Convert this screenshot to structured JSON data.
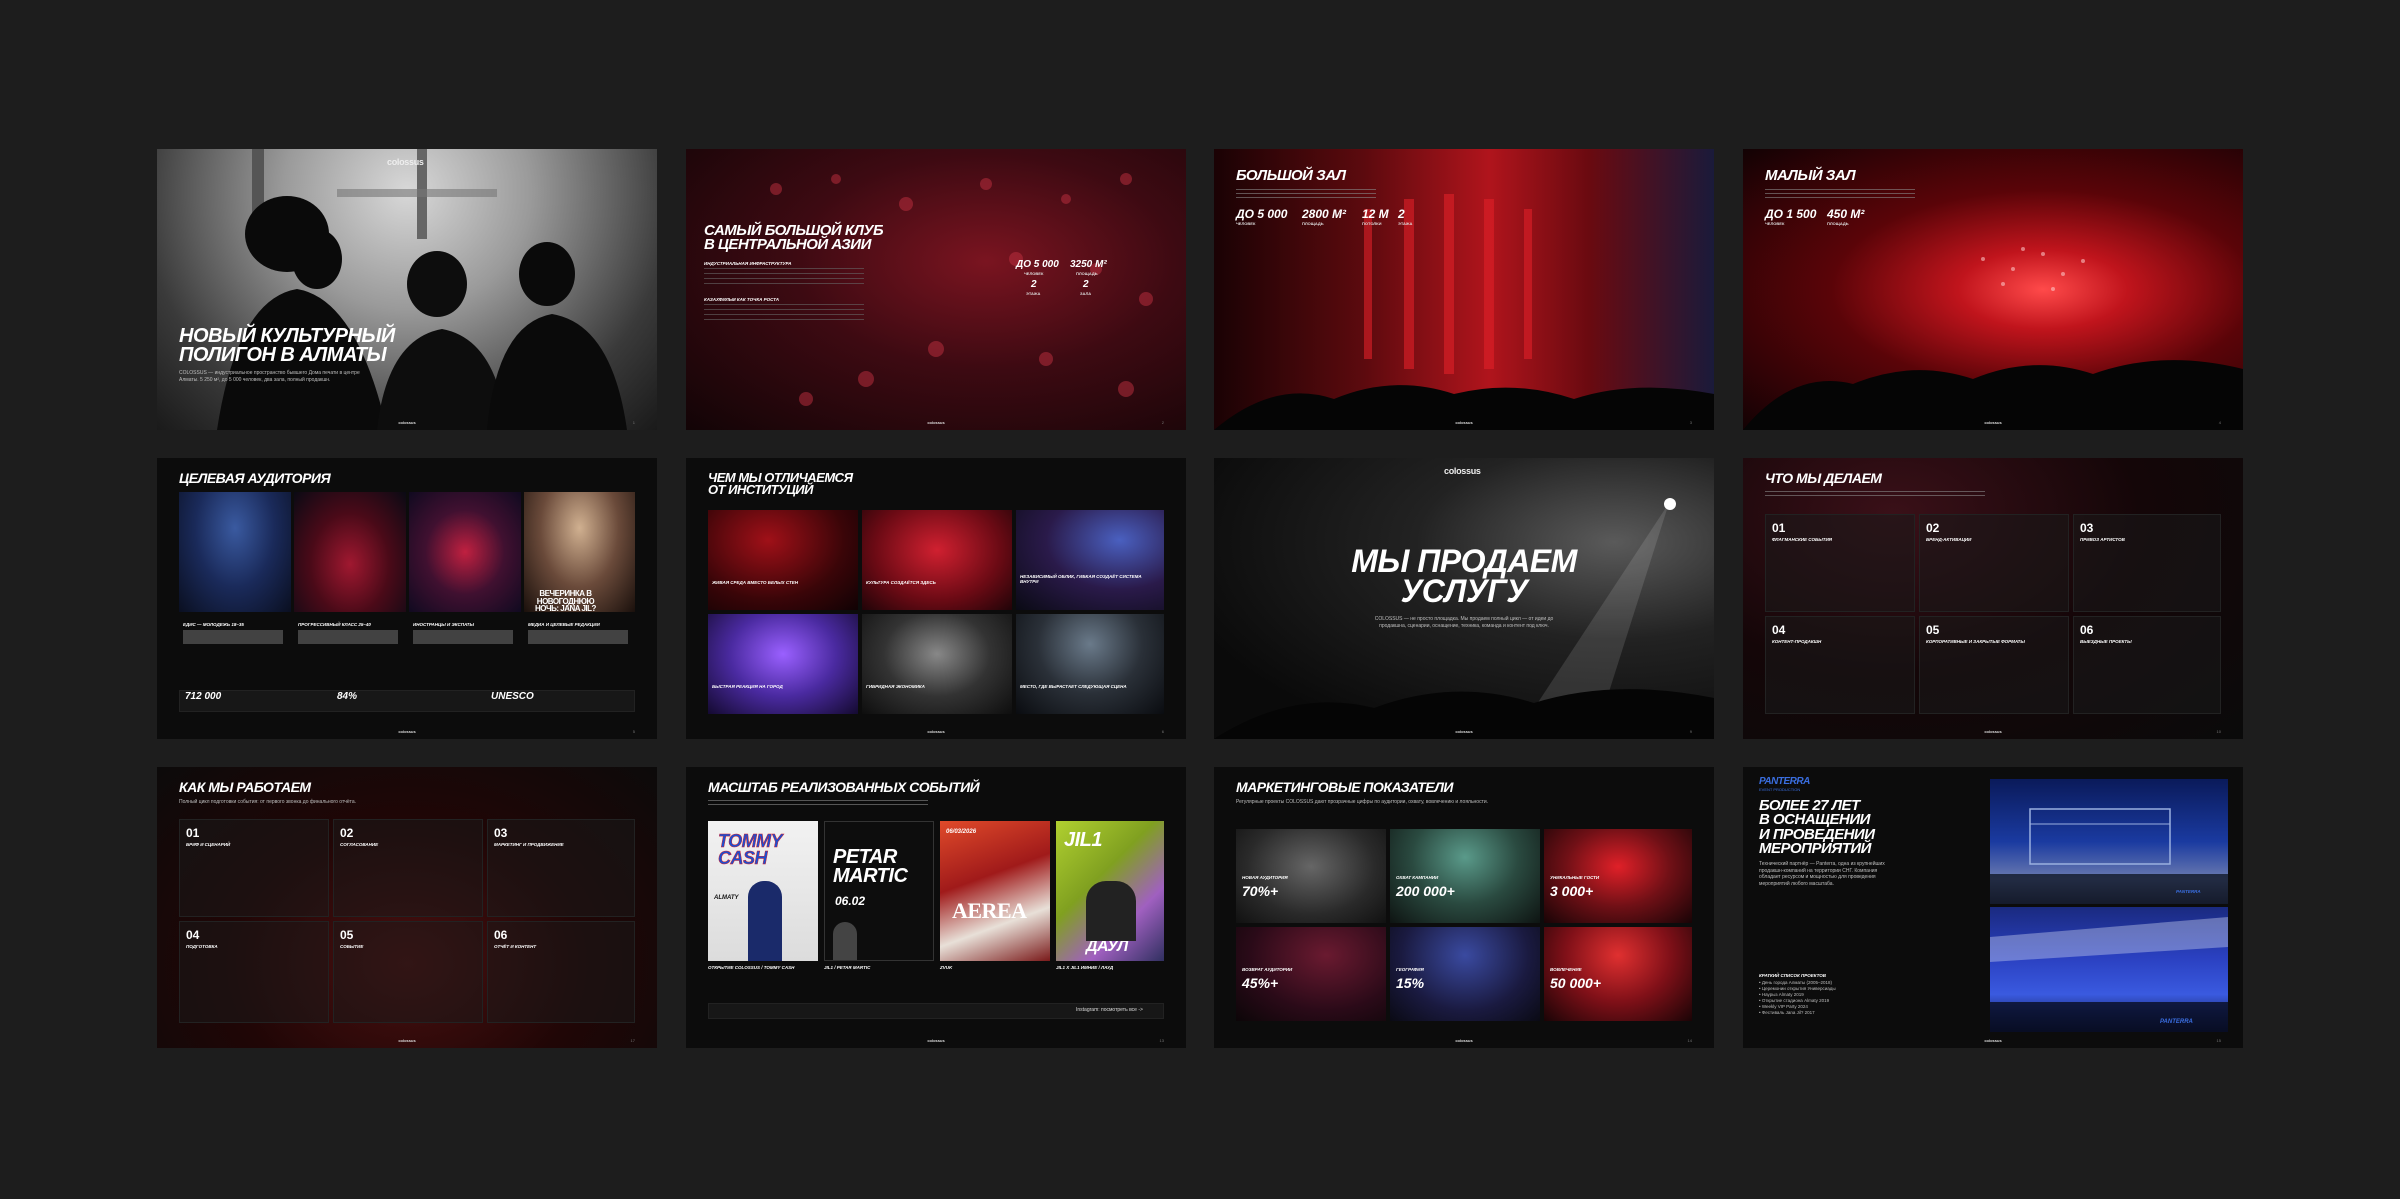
{
  "footer_logo": "colossus",
  "slides": [
    {
      "title": "НОВЫЙ КУЛЬТУРНЫЙ\nПОЛИГОН В АЛМАТЫ",
      "logo": "colossus",
      "desc": "COLOSSUS — индустриальное пространство бывшего Дома печати в центре Алматы. 5 250 м², до 5 000 человек, два зала, полный продакшн.",
      "page": "1"
    },
    {
      "title": "САМЫЙ БОЛЬШОЙ КЛУБ\nВ ЦЕНТРАЛЬНОЙ АЗИИ",
      "sub1": "ИНДУСТРИАЛЬНАЯ ИНФРАСТРУКТУРА",
      "sub2": "КАЗАХФИЛЬМ КАК ТОЧКА РОСТА",
      "stats": [
        {
          "value": "ДО 5 000",
          "label": "ЧЕЛОВЕК"
        },
        {
          "value": "3250 М²",
          "label": "ПЛОЩАДЬ"
        },
        {
          "value": "2",
          "label": "ЭТАЖА"
        },
        {
          "value": "2",
          "label": "ЗАЛА"
        }
      ],
      "page": "2"
    },
    {
      "title": "БОЛЬШОЙ ЗАЛ",
      "stats": [
        {
          "value": "ДО 5 000",
          "label": "ЧЕЛОВЕК"
        },
        {
          "value": "2800 М²",
          "label": "ПЛОЩАДЬ"
        },
        {
          "value": "12 М",
          "label": "ПОТОЛКИ"
        },
        {
          "value": "2",
          "label": "ЭТАЖА"
        }
      ],
      "page": "3"
    },
    {
      "title": "МАЛЫЙ ЗАЛ",
      "stats": [
        {
          "value": "ДО 1 500",
          "label": "ЧЕЛОВЕК"
        },
        {
          "value": "450 М²",
          "label": "ПЛОЩАДЬ"
        }
      ],
      "page": "4"
    },
    {
      "title": "ЦЕЛЕВАЯ АУДИТОРИЯ",
      "photo_caption": "ВЕЧЕРИНКА В\nНОВОГОДНЮЮ\nНОЧЬ: JANA JIL?",
      "columns": [
        "ЕДИС — МОЛОДЕЖЬ 18–35",
        "ПРОГРЕССИВНЫЙ КЛАСС 25–40",
        "ИНОСТРАНЦЫ И ЭКСПАТЫ",
        "МЕДИА И ЦЕЛЕВЫЕ РЕДАКЦИИ"
      ],
      "stats": [
        "712 000",
        "84%",
        "UNESCO"
      ],
      "page": "5"
    },
    {
      "title": "ЧЕМ МЫ ОТЛИЧАЕМСЯ\nОТ ИНСТИТУЦИЙ",
      "cards": [
        "ЖИВАЯ СРЕДА ВМЕСТО БЕЛЫХ СТЕН",
        "КУЛЬТУРА СОЗДАЁТСЯ ЗДЕСЬ",
        "НЕЗАВИСИМЫЙ ОБЛИК, ГИБКАЯ СОЗДАЁТ СИСТЕМА ВНУТРИ",
        "БЫСТРАЯ РЕАКЦИЯ НА ГОРОД",
        "ГИБРИДНАЯ ЭКОНОМИКА",
        "МЕСТО, ГДЕ ВЫРАСТАЕТ СЛЕДУЮЩАЯ СЦЕНА"
      ],
      "page": "6"
    },
    {
      "logo": "colossus",
      "title": "МЫ ПРОДАЕМ\nУСЛУГУ",
      "desc": "COLOSSUS — не просто площадка. Мы продаем полный цикл — от идеи до продакшна, сценарии, оснащение, техника, команда и контент под ключ.",
      "page": "9"
    },
    {
      "title": "ЧТО МЫ ДЕЛАЕМ",
      "items": [
        {
          "n": "01",
          "t": "ФЛАГМАНСКИЕ СОБЫТИЯ"
        },
        {
          "n": "02",
          "t": "БРЕНД-АКТИВАЦИИ"
        },
        {
          "n": "03",
          "t": "ПРИВОЗ АРТИСТОВ"
        },
        {
          "n": "04",
          "t": "КОНТЕНТ-ПРОДАКШН"
        },
        {
          "n": "05",
          "t": "КОРПОРАТИВНЫЕ И ЗАКРЫТЫЕ ФОРМАТЫ"
        },
        {
          "n": "06",
          "t": "ВЫЕЗДНЫЕ ПРОЕКТЫ"
        }
      ],
      "page": "10"
    },
    {
      "title": "КАК МЫ РАБОТАЕМ",
      "desc": "Полный цикл подготовки события: от первого звонка до финального отчёта.",
      "items": [
        {
          "n": "01",
          "t": "БРИФ И СЦЕНАРИЙ"
        },
        {
          "n": "02",
          "t": "СОГЛАСОВАНИЕ"
        },
        {
          "n": "03",
          "t": "МАРКЕТИНГ И ПРОДВИЖЕНИЕ"
        },
        {
          "n": "04",
          "t": "ПОДГОТОВКА"
        },
        {
          "n": "05",
          "t": "СОБЫТИЕ"
        },
        {
          "n": "06",
          "t": "ОТЧЁТ И КОНТЕНТ"
        }
      ],
      "page": "17"
    },
    {
      "title": "МАСШТАБ РЕАЛИЗОВАННЫХ СОБЫТИЙ",
      "posters": [
        {
          "big": "TOMMY\nCASH",
          "sub": "ALMATY",
          "cap": "ОТКРЫТИЕ COLOSSUS / TOMMY CASH"
        },
        {
          "big": "PETAR\nMARTIC",
          "sub": "06.02",
          "cap": "JIL1 / PETAR MARTIC"
        },
        {
          "big": "AEREA",
          "sub": "06/03/2026",
          "cap": "ZVUK"
        },
        {
          "big": "JIL1",
          "sub": "ДАУЛ",
          "cap": "JIL1 X JIL1 ИМНИЕ / ЛАУД"
        }
      ],
      "link": "Instagram: посмотреть все ->",
      "page": "13"
    },
    {
      "title": "МАРКЕТИНГОВЫЕ ПОКАЗАТЕЛИ",
      "desc": "Регулярные проекты COLOSSUS дают прозрачные цифры по аудитории, охвату, вовлечению и лояльности.",
      "stats": [
        {
          "label": "НОВАЯ АУДИТОРИЯ",
          "value": "70%+"
        },
        {
          "label": "ОХВАТ КАМПАНИИ",
          "value": "200 000+"
        },
        {
          "label": "УНИКАЛЬНЫЕ ГОСТИ",
          "value": "3 000+"
        },
        {
          "label": "ВОЗВРАТ АУДИТОРИИ",
          "value": "45%+"
        },
        {
          "label": "ГЕОГРАФИЯ",
          "value": "15%"
        },
        {
          "label": "ВОВЛЕЧЕНИЕ",
          "value": "50 000+"
        }
      ],
      "page": "14"
    },
    {
      "brand": "PANTERRA",
      "brand_sub": "EVENT PRODUCTION",
      "title": "БОЛЕЕ 27 ЛЕТ\nВ ОСНАЩЕНИИ\nИ ПРОВЕДЕНИИ\nМЕРОПРИЯТИЙ",
      "desc": "Технический партнёр — Panterra, одна из крупнейших продакшн-компаний на территории СНГ. Компания обладает ресурсом и мощностью для проведения мероприятий любого масштаба.",
      "list_title": "КРАТКИЙ СПИСОК ПРОЕКТОВ",
      "list": [
        "• День города Алматы (2005–2018)",
        "• Церемонии открытия Универсиады",
        "• Наурыз Almaty 2019",
        "• Открытие стадиона Almaty 2019",
        "• Weekly VIP Party 2024",
        "• Фестиваль Jana Jil? 2017"
      ],
      "photo_tag": "PANTERRA",
      "page": "15"
    }
  ]
}
